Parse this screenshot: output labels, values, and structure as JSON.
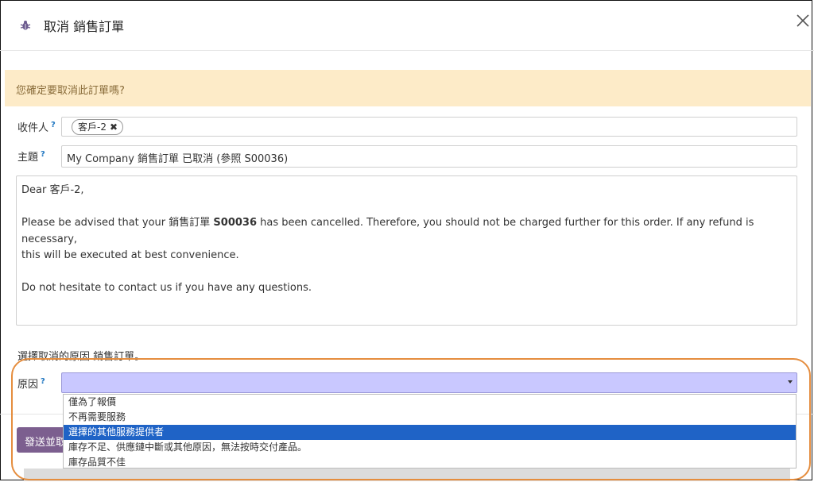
{
  "dialog": {
    "title": "取消 銷售訂單",
    "icon": "bug-icon"
  },
  "warning": "您確定要取消此訂單嗎?",
  "recipients": {
    "label": "收件人",
    "help": "?",
    "tag": "客戶-2",
    "tag_remove": "✖"
  },
  "subject": {
    "label": "主題",
    "help": "?",
    "value": "My Company 銷售訂單 已取消 (參照 S00036)"
  },
  "body": {
    "greeting": "Dear 客戶-2,",
    "line1_pre": "Please be advised that your 銷售訂單 ",
    "line1_ref": "S00036",
    "line1_post": " has been cancelled. Therefore, you should not be charged further for this order. If any refund is necessary,",
    "line2": "this will be executed at best convenience.",
    "line3": "Do not hesitate to contact us if you have any questions."
  },
  "reason": {
    "prompt": "選擇取消的原因 銷售訂單。",
    "label": "原因",
    "help": "?",
    "value": "",
    "options": [
      "僅為了報價",
      "不再需要服務",
      "選擇的其他服務提供者",
      "庫存不足、供應鏈中斷或其他原因，無法按時交付產品。",
      "庫存品質不佳"
    ],
    "highlighted_option": "選擇的其他服務提供者"
  },
  "footer": {
    "send_label": "發送並取消"
  },
  "colors": {
    "primary": "#7c5f8f",
    "warning_bg": "#fdebc8",
    "select_bg": "#c9c8ff",
    "highlight_ring": "#e58d3e",
    "selected_option": "#1f63c6"
  }
}
